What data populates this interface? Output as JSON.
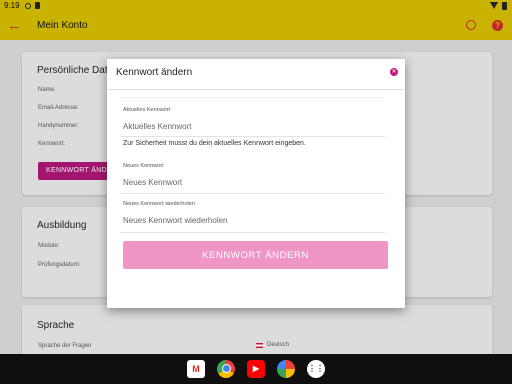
{
  "status_bar": {
    "time": "9:19"
  },
  "app_bar": {
    "title": "Mein Konto",
    "help": "?"
  },
  "personal_card": {
    "title": "Persönliche Dat",
    "labels": [
      "Name:",
      "Email-Adresse:",
      "Handynummer:",
      "Kennwort:"
    ],
    "button_label": "KENNWORT ÄNDERN"
  },
  "education_card": {
    "title": "Ausbildung",
    "labels": [
      "Module:",
      "Prüfungsdatum:"
    ]
  },
  "language_card": {
    "title": "Sprache",
    "label": "Sprache der Fragen",
    "value": "Deutsch"
  },
  "dialog": {
    "title": "Kennwort ändern",
    "current": {
      "label": "Aktuelles Kennwort",
      "placeholder": "Aktuelles Kennwort"
    },
    "hint": "Zur Sicherheit musst du dein aktuelles Kennwort eingeben.",
    "new": {
      "label": "Neues Kennwort",
      "placeholder": "Neues Kennwort"
    },
    "repeat": {
      "label": "Neues Kennwort wiederholen",
      "placeholder": "Neues Kennwort wiederholen"
    },
    "submit_label": "KENNWORT ÄNDERN"
  },
  "taskbar": {
    "apps": [
      "gmail-icon",
      "chrome-icon",
      "youtube-icon",
      "photos-icon",
      "app-drawer-icon"
    ]
  },
  "colors": {
    "accent": "#c9b200",
    "primary": "#a3166f",
    "button_pink": "#f096c6",
    "red": "#c6272a"
  }
}
